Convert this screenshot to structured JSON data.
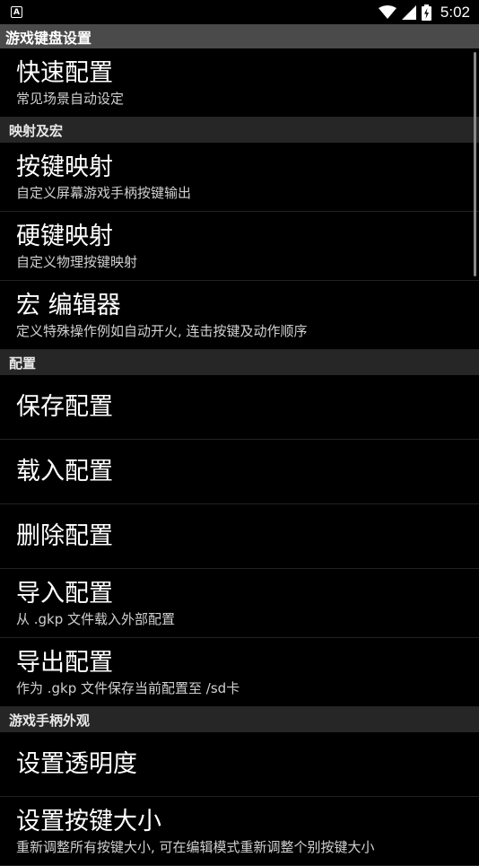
{
  "status_bar": {
    "notification_icon": "A",
    "icons": [
      "wifi-icon",
      "signal-icon",
      "battery-icon"
    ],
    "battery_glyph": "⚡",
    "time": "5:02"
  },
  "title": "游戏键盘设置",
  "sections": {
    "quick": {
      "items": [
        {
          "title": "快速配置",
          "subtitle": "常见场景自动设定"
        }
      ]
    },
    "mapping": {
      "header": "映射及宏",
      "items": [
        {
          "title": "按键映射",
          "subtitle": "自定义屏幕游戏手柄按键输出"
        },
        {
          "title": "硬键映射",
          "subtitle": "自定义物理按键映射"
        },
        {
          "title": "宏 编辑器",
          "subtitle": "定义特殊操作例如自动开火, 连击按键及动作顺序"
        }
      ]
    },
    "config": {
      "header": "配置",
      "items": [
        {
          "title": "保存配置"
        },
        {
          "title": "载入配置"
        },
        {
          "title": "删除配置"
        },
        {
          "title": "导入配置",
          "subtitle": "从 .gkp 文件载入外部配置"
        },
        {
          "title": "导出配置",
          "subtitle": "作为 .gkp 文件保存当前配置至 /sd卡"
        }
      ]
    },
    "appearance": {
      "header": "游戏手柄外观",
      "items": [
        {
          "title": "设置透明度"
        },
        {
          "title": "设置按键大小",
          "subtitle": "重新调整所有按键大小, 可在编辑模式重新调整个别按键大小"
        }
      ]
    }
  },
  "colors": {
    "background": "#000000",
    "title_bar": "#4a4a4a",
    "section_header": "#262626",
    "subtitle_text": "#d0d0d0"
  }
}
